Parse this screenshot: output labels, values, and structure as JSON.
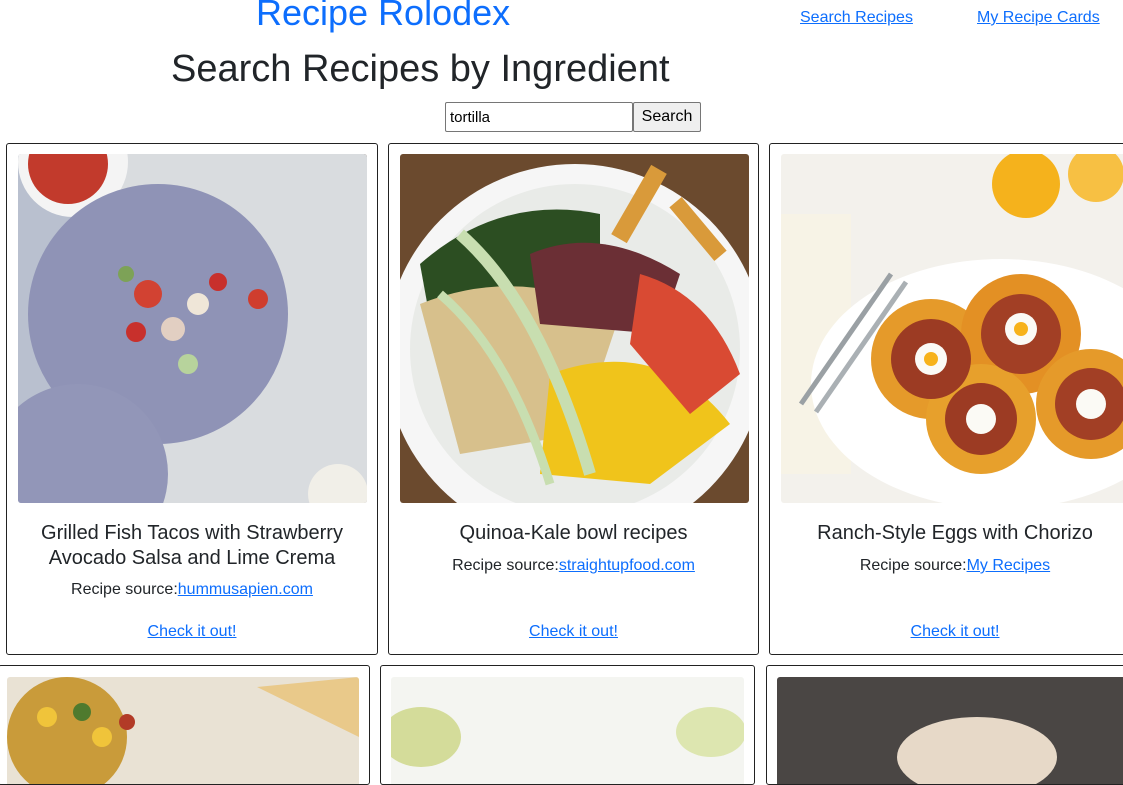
{
  "header": {
    "brand": "Recipe Rolodex",
    "nav": {
      "search": "Search Recipes",
      "cards": "My Recipe Cards"
    }
  },
  "main": {
    "title": "Search Recipes by Ingredient",
    "search": {
      "value": "tortilla",
      "button": "Search"
    },
    "cards": [
      {
        "title": "Grilled Fish Tacos with Strawberry Avocado Salsa and Lime Crema",
        "source_label": "Recipe source:",
        "source_link": "hummusapien.com",
        "cta": "Check it out!",
        "image": "fish-tacos-photo"
      },
      {
        "title": "Quinoa-Kale bowl recipes",
        "source_label": "Recipe source:",
        "source_link": "straightupfood.com",
        "cta": "Check it out!",
        "image": "quinoa-kale-bowl-photo"
      },
      {
        "title": "Ranch-Style Eggs with Chorizo",
        "source_label": "Recipe source:",
        "source_link": "My Recipes",
        "cta": "Check it out!",
        "image": "ranch-eggs-photo"
      }
    ]
  },
  "colors": {
    "link": "#0d6efd",
    "text": "#212529",
    "card_border": "#222222"
  }
}
